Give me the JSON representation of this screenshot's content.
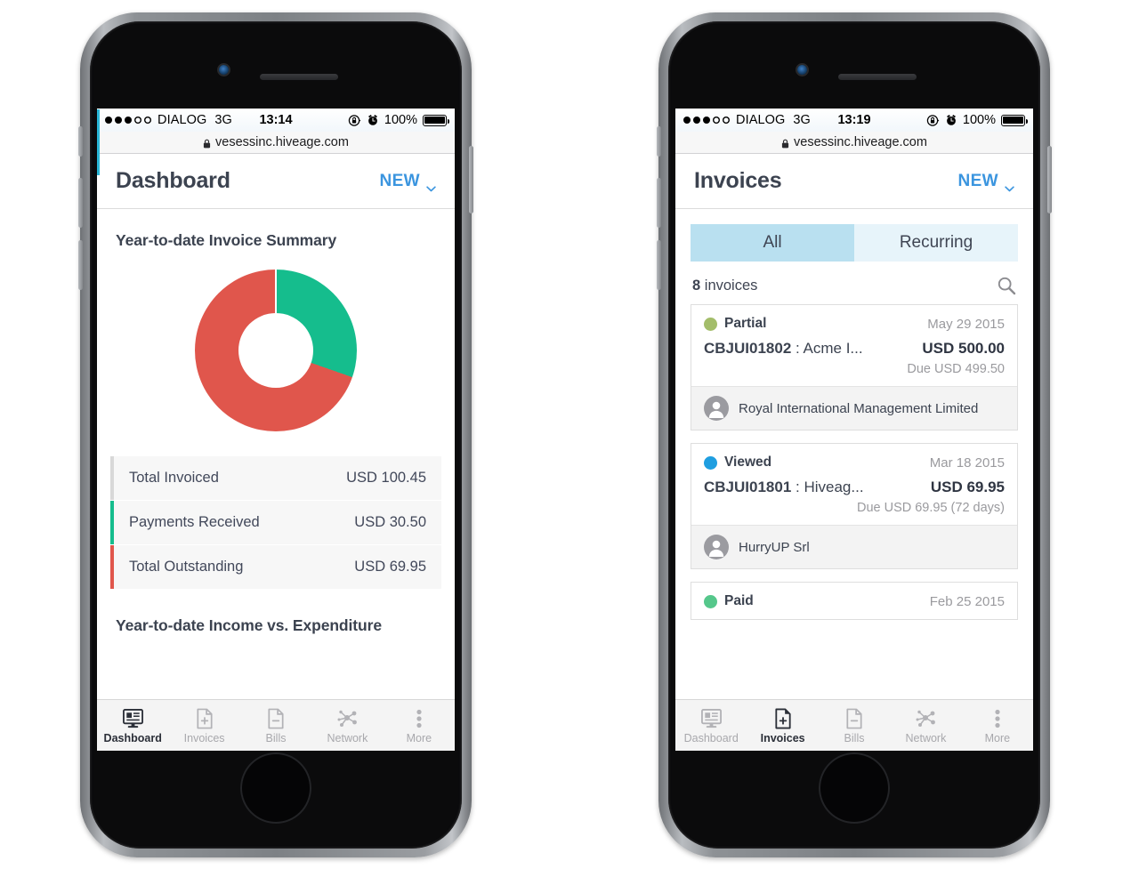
{
  "theme": {
    "accent_blue": "#3b95df",
    "green": "#15bd8d",
    "red": "#e0564c",
    "seg_active": "#b9e0f0",
    "seg_inactive": "#e7f4fa",
    "text_dark": "#3c4350",
    "muted": "#9a9a9e"
  },
  "phones": [
    {
      "id": "dashboard-phone",
      "statusbar": {
        "signal_filled": 3,
        "signal_empty": 2,
        "carrier": "DIALOG",
        "network": "3G",
        "time": "13:14",
        "rotation_lock_icon": "rotation-lock-icon",
        "alarm_icon": "alarm-clock-icon",
        "battery_percent": "100%",
        "battery_icon": "battery-full-icon"
      },
      "urlbar": {
        "lock_icon": "padlock-icon",
        "url": "vesessinc.hiveage.com"
      },
      "header": {
        "title": "Dashboard",
        "new_label": "NEW",
        "chevron_icon": "chevron-down-icon"
      },
      "dashboard": {
        "summary_title": "Year-to-date Invoice Summary",
        "rows": [
          {
            "label": "Total Invoiced",
            "value": "USD 100.45",
            "bar_color": "#d8d8d8"
          },
          {
            "label": "Payments Received",
            "value": "USD 30.50",
            "bar_color": "#15bd8d"
          },
          {
            "label": "Total Outstanding",
            "value": "USD 69.95",
            "bar_color": "#e0564c"
          }
        ],
        "income_title": "Year-to-date Income vs. Expenditure"
      },
      "tabs": [
        {
          "label": "Dashboard",
          "icon": "dashboard-monitor-icon",
          "active": true
        },
        {
          "label": "Invoices",
          "icon": "invoice-document-plus-icon",
          "active": false
        },
        {
          "label": "Bills",
          "icon": "bill-document-minus-icon",
          "active": false
        },
        {
          "label": "Network",
          "icon": "network-nodes-icon",
          "active": false
        },
        {
          "label": "More",
          "icon": "more-dots-icon",
          "active": false
        }
      ]
    },
    {
      "id": "invoices-phone",
      "statusbar": {
        "signal_filled": 3,
        "signal_empty": 2,
        "carrier": "DIALOG",
        "network": "3G",
        "time": "13:19",
        "rotation_lock_icon": "rotation-lock-icon",
        "alarm_icon": "alarm-clock-icon",
        "battery_percent": "100%",
        "battery_icon": "battery-full-icon"
      },
      "urlbar": {
        "lock_icon": "padlock-icon",
        "url": "vesessinc.hiveage.com"
      },
      "header": {
        "title": "Invoices",
        "new_label": "NEW",
        "chevron_icon": "chevron-down-icon"
      },
      "invoices": {
        "segments": [
          {
            "label": "All",
            "active": true
          },
          {
            "label": "Recurring",
            "active": false
          }
        ],
        "count_number": "8",
        "count_suffix": " invoices",
        "search_icon": "search-icon",
        "cards": [
          {
            "status": "Partial",
            "status_color": "#a3bd6a",
            "date": "May 29 2015",
            "number": "CBJUI01802",
            "separator": " : ",
            "client_short": "Acme I...",
            "amount": "USD 500.00",
            "due": "Due USD 499.50",
            "client": "Royal International Management Limited",
            "avatar_icon": "person-avatar-icon"
          },
          {
            "status": "Viewed",
            "status_color": "#1f9ee0",
            "date": "Mar 18 2015",
            "number": "CBJUI01801",
            "separator": " : ",
            "client_short": "Hiveag...",
            "amount": "USD 69.95",
            "due": "Due USD 69.95 (72 days)",
            "client": "HurryUP Srl",
            "avatar_icon": "person-avatar-icon"
          },
          {
            "status": "Paid",
            "status_color": "#55c78b",
            "date": "Feb 25 2015",
            "number": "",
            "separator": "",
            "client_short": "",
            "amount": "",
            "due": "",
            "client": "",
            "avatar_icon": "person-avatar-icon"
          }
        ]
      },
      "tabs": [
        {
          "label": "Dashboard",
          "icon": "dashboard-monitor-icon",
          "active": false
        },
        {
          "label": "Invoices",
          "icon": "invoice-document-plus-icon",
          "active": true
        },
        {
          "label": "Bills",
          "icon": "bill-document-minus-icon",
          "active": false
        },
        {
          "label": "Network",
          "icon": "network-nodes-icon",
          "active": false
        },
        {
          "label": "More",
          "icon": "more-dots-icon",
          "active": false
        }
      ]
    }
  ],
  "chart_data": {
    "type": "pie",
    "title": "Year-to-date Invoice Summary",
    "subtype": "donut",
    "categories": [
      "Payments Received",
      "Total Outstanding"
    ],
    "values": [
      30.5,
      69.95
    ],
    "percentages": [
      30.4,
      69.6
    ],
    "colors": [
      "#15bd8d",
      "#e0564c"
    ],
    "total": 100.45,
    "unit": "USD",
    "start_angle_deg": 0,
    "legend": "none",
    "labels_shown": false
  }
}
